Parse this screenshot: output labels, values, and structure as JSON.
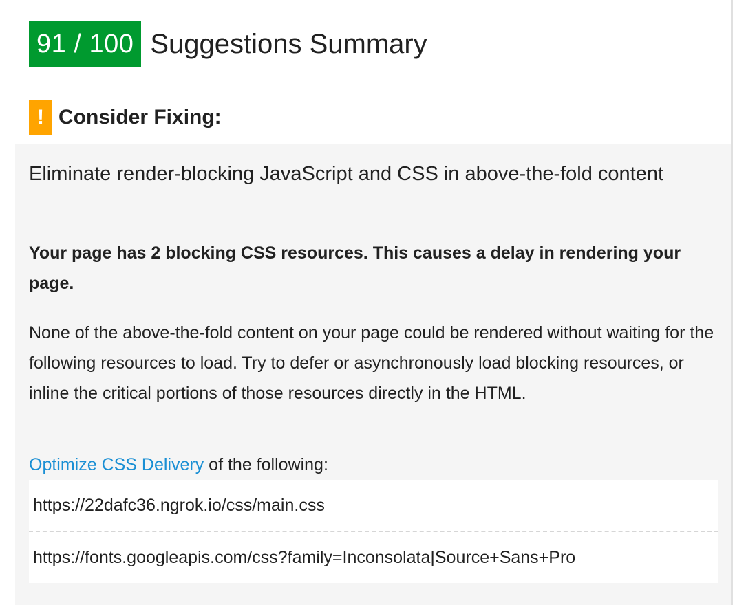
{
  "header": {
    "score": "91 / 100",
    "title": "Suggestions Summary",
    "score_color": "#009a2f"
  },
  "section": {
    "label": "Consider Fixing:",
    "icon": "warning-icon",
    "icon_glyph": "!",
    "icon_color": "#ffa400"
  },
  "rule": {
    "title": "Eliminate render-blocking JavaScript and CSS in above-the-fold content",
    "summary": "Your page has 2 blocking CSS resources. This causes a delay in rendering your page.",
    "explanation": "None of the above-the-fold content on your page could be rendered without waiting for the following resources to load. Try to defer or asynchronously load blocking resources, or inline the critical portions of those resources directly in the HTML.",
    "optimize_link": "Optimize CSS Delivery",
    "optimize_suffix": " of the following:",
    "link_color": "#1a8fd4",
    "urls": [
      "https://22dafc36.ngrok.io/css/main.css",
      "https://fonts.googleapis.com/css?family=Inconsolata|Source+Sans+Pro"
    ]
  }
}
